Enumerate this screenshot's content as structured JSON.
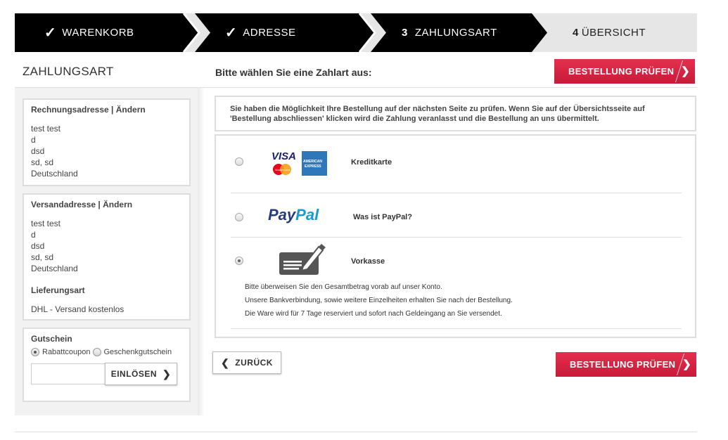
{
  "steps": [
    {
      "mark": "✓",
      "label": "WARENKORB"
    },
    {
      "mark": "✓",
      "label": "ADRESSE"
    },
    {
      "mark": "3",
      "label": "ZAHLUNGSART"
    },
    {
      "mark": "4",
      "label": "ÜBERSICHT"
    }
  ],
  "sidebar": {
    "title": "ZAHLUNGSART",
    "billing": {
      "heading": "Rechnungsadresse | Ändern",
      "lines": [
        "test test",
        "d",
        "dsd",
        "sd, sd",
        "Deutschland"
      ]
    },
    "shipping": {
      "heading": "Versandadresse | Ändern",
      "lines": [
        "test test",
        "d",
        "dsd",
        "sd, sd",
        "Deutschland"
      ],
      "delivery_heading": "Lieferungsart",
      "delivery_value": "DHL - Versand kostenlos"
    },
    "coupon": {
      "heading": "Gutschein",
      "option_discount": "Rabattcoupon",
      "option_gift": "Geschenkgutschein",
      "selected": "Rabattcoupon",
      "input_value": "",
      "redeem_label": "EINLÖSEN"
    }
  },
  "main": {
    "title": "Bitte wählen Sie eine Zahlart aus:",
    "check_order_label": "BESTELLUNG PRÜFEN",
    "info_text_1": "Sie haben die Möglichkeit Ihre Bestellung auf der nächsten Seite zu prüfen. Wenn Sie auf der Übersichtsseite auf",
    "info_text_2": "'Bestellung abschliessen' klicken wird die Zahlung veranlasst und die Bestellung an uns übermittelt.",
    "payment_methods": [
      {
        "label": "Kreditkarte",
        "icon": "credit-card-logos",
        "selected": false
      },
      {
        "label": "Was ist PayPal?",
        "icon": "paypal-logo",
        "selected": false
      },
      {
        "label": "Vorkasse",
        "icon": "prepayment-icon",
        "selected": true
      }
    ],
    "vorkasse_text": [
      "Bitte überweisen Sie den Gesamtbetrag vorab auf unser Konto.",
      "Unsere Bankverbindung, sowie weitere Einzelheiten erhalten Sie nach der Bestellung.",
      "Die Ware wird für 7 Tage reserviert und sofort nach Geldeingang an Sie versendet."
    ],
    "logo_text": {
      "visa": "VISA",
      "mastercard": "MasterCard",
      "amex": "AMERICAN EXPRESS",
      "paypal_1": "Pay",
      "paypal_2": "Pal"
    },
    "back_label": "ZURÜCK"
  },
  "colors": {
    "accent": "#d42541",
    "step_dark": "#000000",
    "step_light": "#e6e6e6"
  }
}
